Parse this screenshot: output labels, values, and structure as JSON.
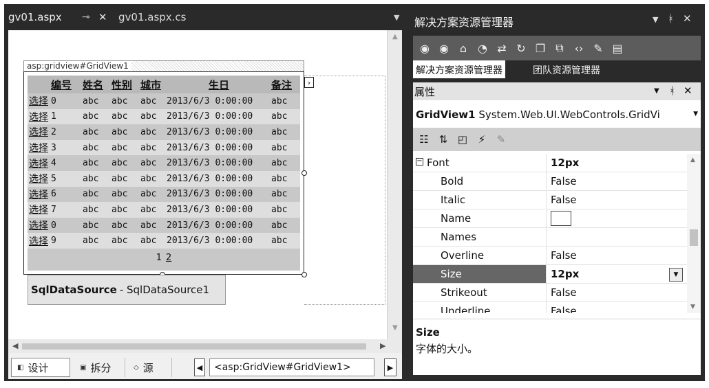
{
  "doc_tabs": {
    "active": "gv01.aspx",
    "inactive": "gv01.aspx.cs"
  },
  "design": {
    "smart_tag": "asp:gridview#GridView1",
    "grid": {
      "headers": [
        "编号",
        "姓名",
        "性别",
        "城市",
        "生日",
        "备注"
      ],
      "select_label": "选择",
      "rows": [
        {
          "id": "0",
          "name": "abc",
          "sex": "abc",
          "city": "abc",
          "birthday": "2013/6/3 0:00:00",
          "note": "abc"
        },
        {
          "id": "1",
          "name": "abc",
          "sex": "abc",
          "city": "abc",
          "birthday": "2013/6/3 0:00:00",
          "note": "abc"
        },
        {
          "id": "2",
          "name": "abc",
          "sex": "abc",
          "city": "abc",
          "birthday": "2013/6/3 0:00:00",
          "note": "abc"
        },
        {
          "id": "3",
          "name": "abc",
          "sex": "abc",
          "city": "abc",
          "birthday": "2013/6/3 0:00:00",
          "note": "abc"
        },
        {
          "id": "4",
          "name": "abc",
          "sex": "abc",
          "city": "abc",
          "birthday": "2013/6/3 0:00:00",
          "note": "abc"
        },
        {
          "id": "5",
          "name": "abc",
          "sex": "abc",
          "city": "abc",
          "birthday": "2013/6/3 0:00:00",
          "note": "abc"
        },
        {
          "id": "6",
          "name": "abc",
          "sex": "abc",
          "city": "abc",
          "birthday": "2013/6/3 0:00:00",
          "note": "abc"
        },
        {
          "id": "7",
          "name": "abc",
          "sex": "abc",
          "city": "abc",
          "birthday": "2013/6/3 0:00:00",
          "note": "abc"
        },
        {
          "id": "0",
          "name": "abc",
          "sex": "abc",
          "city": "abc",
          "birthday": "2013/6/3 0:00:00",
          "note": "abc"
        },
        {
          "id": "9",
          "name": "abc",
          "sex": "abc",
          "city": "abc",
          "birthday": "2013/6/3 0:00:00",
          "note": "abc"
        }
      ],
      "pager": [
        "1",
        "2"
      ]
    },
    "sqlds": {
      "type": "SqlDataSource",
      "id": "- SqlDataSource1"
    }
  },
  "bottom_bar": {
    "design_label": "设计",
    "split_label": "拆分",
    "source_label": "源",
    "breadcrumb": "<asp:GridView#GridView1>"
  },
  "solution_explorer": {
    "title": "解决方案资源管理器",
    "tab_solution": "解决方案资源管理器",
    "tab_team": "团队资源管理器"
  },
  "properties": {
    "title": "属性",
    "object_name": "GridView1",
    "object_type": "System.Web.UI.WebControls.GridVi",
    "category": {
      "name": "Font",
      "value": "12px"
    },
    "rows": [
      {
        "name": "Bold",
        "value": "False"
      },
      {
        "name": "Italic",
        "value": "False"
      },
      {
        "name": "Name",
        "value": ""
      },
      {
        "name": "Names",
        "value": ""
      },
      {
        "name": "Overline",
        "value": "False"
      },
      {
        "name": "Size",
        "value": "12px"
      },
      {
        "name": "Strikeout",
        "value": "False"
      },
      {
        "name": "Underline",
        "value": "False"
      }
    ],
    "selected": "Size",
    "description": {
      "title": "Size",
      "text": "字体的大小。"
    }
  },
  "icons": {
    "pin": "pin-icon",
    "close": "close-icon",
    "dropdown": "dropdown-arrow-icon"
  }
}
